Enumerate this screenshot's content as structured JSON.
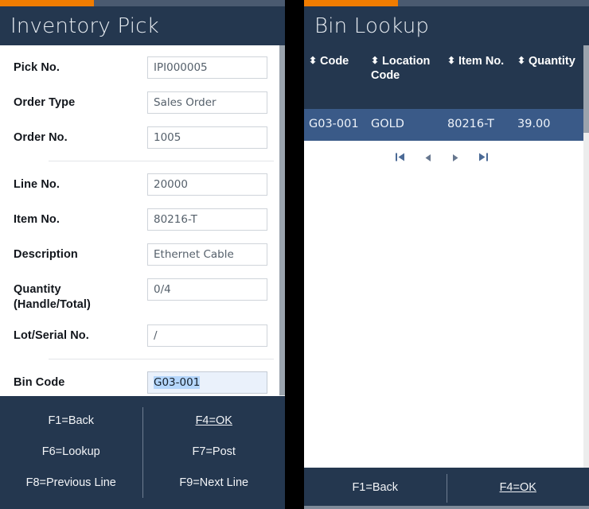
{
  "left_panel": {
    "title": "Inventory Pick",
    "progress_percent": 33,
    "fields": [
      {
        "label": "Pick No.",
        "value": "IPI000005"
      },
      {
        "label": "Order Type",
        "value": "Sales Order"
      },
      {
        "label": "Order No.",
        "value": "1005"
      },
      {
        "label": "Line No.",
        "value": "20000"
      },
      {
        "label": "Item No.",
        "value": "80216-T"
      },
      {
        "label": "Description",
        "value": "Ethernet Cable"
      },
      {
        "label": "Quantity (Handle/Total)",
        "value": "0/4"
      },
      {
        "label": "Lot/Serial No.",
        "value": "/"
      },
      {
        "label": "Bin Code",
        "value": "G03-001"
      }
    ],
    "quantity_label_line1": "Quantity",
    "quantity_label_line2": "(Handle/Total)",
    "keys": [
      {
        "label": "F1=Back",
        "underlined": false
      },
      {
        "label": "F4=OK",
        "underlined": true
      },
      {
        "label": "F6=Lookup",
        "underlined": false
      },
      {
        "label": "F7=Post",
        "underlined": false
      },
      {
        "label": "F8=Previous Line",
        "underlined": false
      },
      {
        "label": "F9=Next Line",
        "underlined": false
      }
    ]
  },
  "right_panel": {
    "title": "Bin Lookup",
    "progress_percent": 33,
    "table": {
      "columns": [
        "Code",
        "Location Code",
        "Item No.",
        "Quantity"
      ],
      "sort_icon": "sort-icon",
      "rows": [
        {
          "code": "G03-001",
          "location_code": "GOLD",
          "item_no": "80216-T",
          "quantity": "39.00",
          "selected": true
        }
      ]
    },
    "pager": {
      "first": "first-page-icon",
      "previous": "previous-page-icon",
      "next": "next-page-icon",
      "last": "last-page-icon",
      "first_glyph": "⏮",
      "previous_glyph": "◀",
      "next_glyph": "▶",
      "last_glyph": "⏭"
    },
    "keys": [
      {
        "label": "F1=Back",
        "underlined": false
      },
      {
        "label": "F4=OK",
        "underlined": true
      }
    ]
  },
  "colors": {
    "panel_header": "#24374f",
    "accent_orange": "#f07c00",
    "progress_track": "#4a5a70",
    "row_selected": "#3a5a88",
    "focus_field_bg": "#eaf1fb",
    "text_selection": "#b5d6fb"
  },
  "glyphs": {
    "sorter": "⬍"
  }
}
